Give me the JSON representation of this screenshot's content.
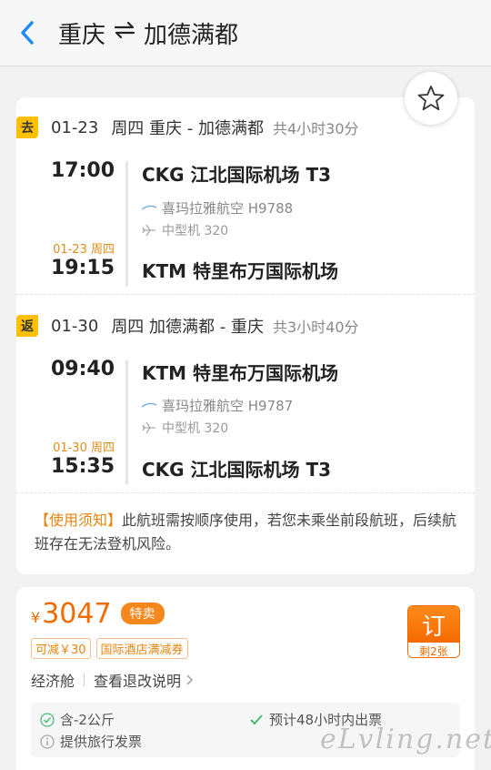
{
  "header": {
    "origin": "重庆",
    "destination": "加德满都",
    "swap_icon": "round-trip-arrows-icon",
    "back_icon": "chevron-left-icon"
  },
  "favorite": {
    "icon": "star-outline-icon"
  },
  "outbound": {
    "badge": "去",
    "date": "01-23",
    "weekday": "周四",
    "route": "重庆 - 加德满都",
    "duration": "共4小时30分",
    "dep_time": "17:00",
    "dep_airport": "CKG 江北国际机场 T3",
    "airline": "喜玛拉雅航空 H9788",
    "aircraft": "中型机 320",
    "arr_date": "01-23 周四",
    "arr_time": "19:15",
    "arr_airport": "KTM 特里布万国际机场"
  },
  "inbound": {
    "badge": "返",
    "date": "01-30",
    "weekday": "周四",
    "route": "加德满都 - 重庆",
    "duration": "共3小时40分",
    "dep_time": "09:40",
    "dep_airport": "KTM 特里布万国际机场",
    "airline": "喜玛拉雅航空 H9787",
    "aircraft": "中型机 320",
    "arr_date": "01-30 周四",
    "arr_time": "15:35",
    "arr_airport": "CKG 江北国际机场 T3"
  },
  "notice": {
    "tag": "【使用须知】",
    "text": "此航班需按顺序使用，若您未乘坐前段航班，后续航班存在无法登机风险。"
  },
  "price": {
    "currency": "¥",
    "amount": "3047",
    "sale_tag": "特卖",
    "coupon1": "可减￥30",
    "coupon2": "国际酒店满减券",
    "cabin": "经济舱",
    "refund_link": "查看退改说明",
    "book_label": "订",
    "remaining": "剩2张"
  },
  "extras": {
    "baggage": "含-2公斤",
    "ticketing": "预计48小时内出票",
    "invoice": "提供旅行发票"
  },
  "watermark": "eLvling.net",
  "colors": {
    "accent": "#f06b00",
    "badge": "#ffc000",
    "link_blue": "#1a8cff"
  }
}
